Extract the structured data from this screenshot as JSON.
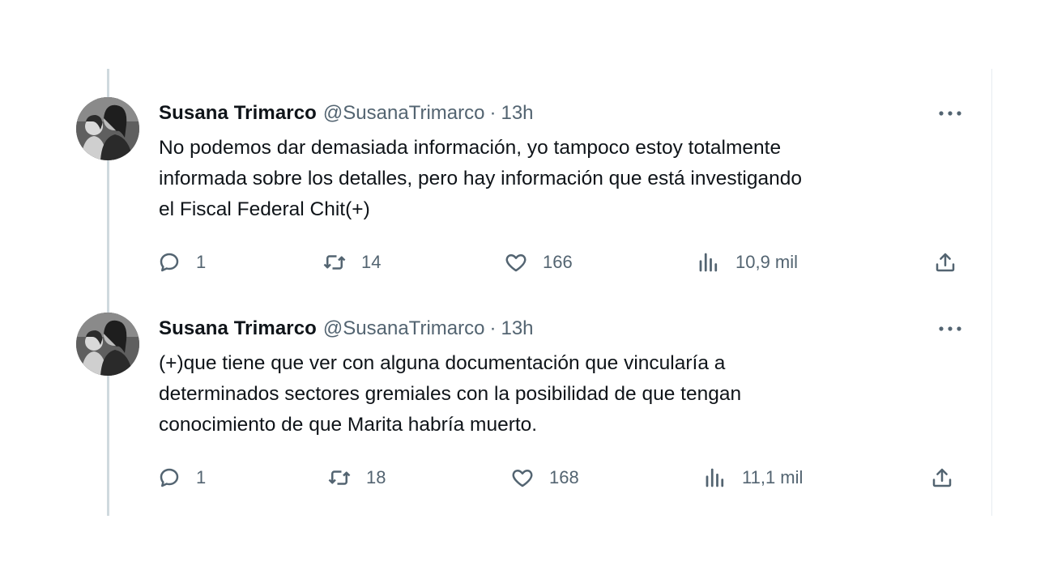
{
  "tweets": [
    {
      "author": {
        "name": "Susana Trimarco",
        "handle": "@SusanaTrimarco",
        "separator": "·",
        "time": "13h"
      },
      "text_lines": [
        "No podemos dar demasiada información, yo tampoco estoy totalmente",
        "informada sobre los detalles, pero hay información que está investigando",
        "el Fiscal Federal Chit(+)"
      ],
      "stats": {
        "replies": "1",
        "retweets": "14",
        "likes": "166",
        "views": "10,9 mil"
      }
    },
    {
      "author": {
        "name": "Susana Trimarco",
        "handle": "@SusanaTrimarco",
        "separator": "·",
        "time": "13h"
      },
      "text_lines": [
        "(+)que tiene que ver con alguna documentación que vincularía a",
        "determinados sectores gremiales con la posibilidad de que tengan",
        "conocimiento de que Marita habría muerto."
      ],
      "stats": {
        "replies": "1",
        "retweets": "18",
        "likes": "168",
        "views": "11,1 mil"
      }
    }
  ],
  "icons": {
    "reply": "reply-icon",
    "retweet": "retweet-icon",
    "like": "like-icon",
    "views": "views-icon",
    "share": "share-icon",
    "more": "more-icon"
  },
  "colors": {
    "text_primary": "#0f1419",
    "text_secondary": "#536471",
    "thread_line": "#cfd9de"
  }
}
